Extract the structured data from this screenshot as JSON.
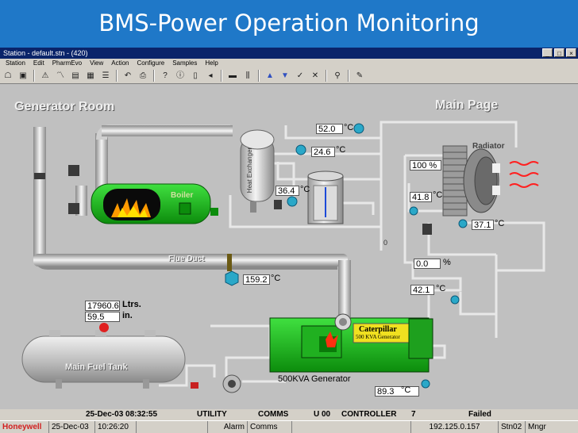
{
  "slide": {
    "title": "BMS-Power Operation Monitoring"
  },
  "window": {
    "title": "Station - default.stn - (420)",
    "controls": [
      "_",
      "□",
      "×"
    ]
  },
  "menu": [
    "Station",
    "Edit",
    "PharmEvo",
    "View",
    "Action",
    "Configure",
    "Samples",
    "Help"
  ],
  "canvas": {
    "room_title": "Generator Room",
    "main_page": "Main Page",
    "labels": {
      "radiator": "Radiator",
      "boiler": "Boiler",
      "heat_exchanger": "Heat Exchanger",
      "flue_duct": "Flue Duct",
      "fuel_tank": "Main Fuel Tank",
      "generator": "500KVA Generator",
      "caterpillar": "Caterpillar",
      "caterpillar_sub": "500 KVA Generator",
      "zero": "0"
    },
    "readouts": {
      "top_temp": "52.0",
      "hx_temp": "24.6",
      "tank_temp": "36.4",
      "radiator_pct": "100 %",
      "radiator_temp": "41.8",
      "radiator_out_temp": "37.1",
      "valve_pct": "0.0",
      "valve_pct_unit": "%",
      "return_temp": "42.1",
      "flue_temp": "159.2",
      "fuel_litres": "17960.6",
      "fuel_litres_unit": "Ltrs.",
      "fuel_in": "59.5",
      "fuel_in_unit": "in.",
      "gen_temp": "89.3"
    },
    "unit_degc": "°C"
  },
  "status_bar": {
    "datetime": "25-Dec-03 08:32:55",
    "utility": "UTILITY",
    "comms": "COMMS",
    "u00": "U 00",
    "controller": "CONTROLLER",
    "controller_num": "7",
    "failed": "Failed"
  },
  "status_bar2": {
    "brand": "Honeywell",
    "date": "25-Dec-03",
    "time": "10:26:20",
    "alarm": "Alarm",
    "comms": "Comms",
    "ip": "192.125.0.157",
    "station": "Stn02",
    "user": "Mngr"
  },
  "colors": {
    "banner": "#1f78c8",
    "pipe": "#d8d8d8",
    "equipment_green": "#18c418",
    "canvas": "#c0c0c0"
  }
}
